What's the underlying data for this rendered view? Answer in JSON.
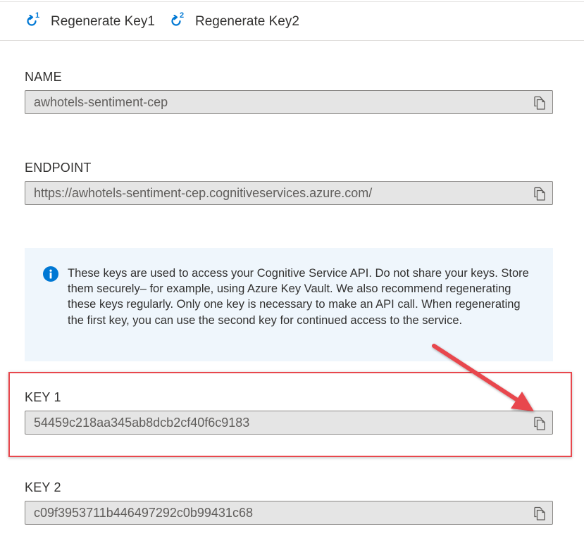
{
  "toolbar": {
    "regen_key1": {
      "label": "Regenerate Key1",
      "badge": "1"
    },
    "regen_key2": {
      "label": "Regenerate Key2",
      "badge": "2"
    }
  },
  "fields": {
    "name": {
      "label": "NAME",
      "value": "awhotels-sentiment-cep"
    },
    "endpoint": {
      "label": "ENDPOINT",
      "value": "https://awhotels-sentiment-cep.cognitiveservices.azure.com/"
    },
    "key1": {
      "label": "KEY 1",
      "value": "54459c218aa345ab8dcb2cf40f6c9183"
    },
    "key2": {
      "label": "KEY 2",
      "value": "c09f3953711b446497292c0b99431c68"
    }
  },
  "info": {
    "icon": "info-icon",
    "text": "These keys are used to access your Cognitive Service API. Do not share your keys. Store them securely– for example, using Azure Key Vault. We also recommend regenerating these keys regularly. Only one key is necessary to make an API call. When regenerating the first key, you can use the second key for continued access to the service."
  },
  "icons": {
    "copy": "copy-icon",
    "regenerate": "refresh-icon"
  },
  "colors": {
    "accent": "#0078d4",
    "highlight": "#e8474d",
    "info_bg": "#eff6fc",
    "field_bg": "#e5e5e5"
  }
}
